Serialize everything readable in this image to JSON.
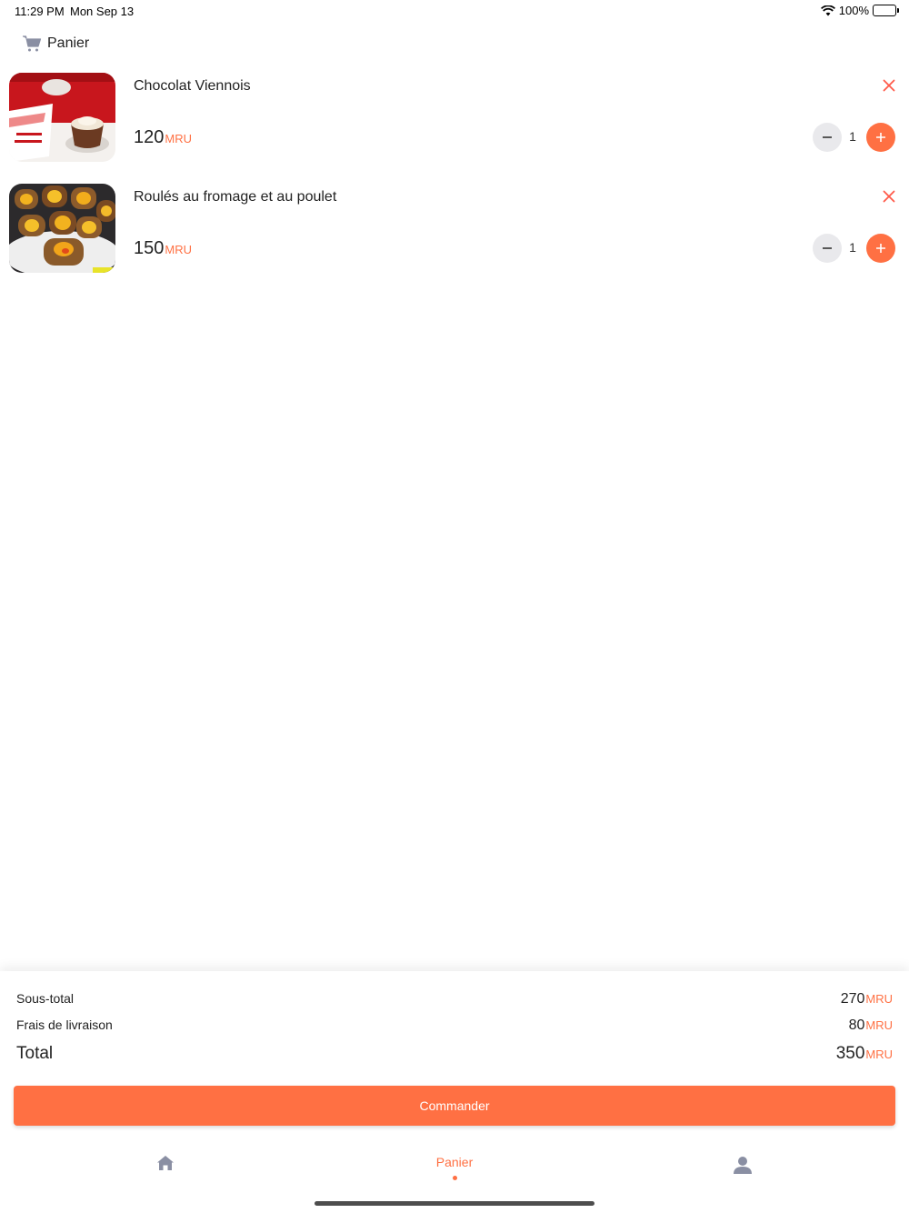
{
  "status_bar": {
    "time": "11:29 PM",
    "date": "Mon Sep 13",
    "battery": "100%"
  },
  "header": {
    "title": "Panier",
    "icon": "cart-icon"
  },
  "cart": {
    "items": [
      {
        "name": "Chocolat Viennois",
        "price": "120",
        "currency": "MRU",
        "quantity": "1"
      },
      {
        "name": "Roulés au fromage et au poulet",
        "price": "150",
        "currency": "MRU",
        "quantity": "1"
      }
    ]
  },
  "summary": {
    "subtotal_label": "Sous-total",
    "subtotal_value": "270",
    "subtotal_currency": "MRU",
    "delivery_label": "Frais de livraison",
    "delivery_value": "80",
    "delivery_currency": "MRU",
    "total_label": "Total",
    "total_value": "350",
    "total_currency": "MRU"
  },
  "order_button": {
    "label": "Commander"
  },
  "bottom_nav": {
    "items": [
      {
        "icon": "home-icon",
        "label": ""
      },
      {
        "label": "Panier",
        "active": true
      },
      {
        "icon": "profile-icon",
        "label": ""
      }
    ]
  },
  "colors": {
    "accent": "#ff7043",
    "stepper_bg": "#e9e9ec",
    "nav_inactive": "#8a8fa3"
  }
}
